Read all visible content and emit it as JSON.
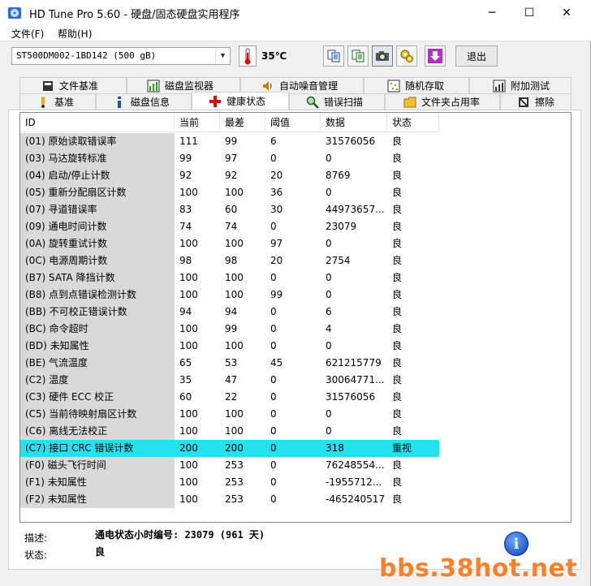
{
  "window": {
    "title": "HD Tune Pro 5.60 - 硬盘/固态硬盘实用程序",
    "minimize": "─",
    "maximize": "☐",
    "close": "✕"
  },
  "menu": {
    "file": "文件(F)",
    "help": "帮助(H)"
  },
  "toolbar": {
    "drive": "ST500DM002-1BD142 (500 gB)",
    "temperature": "35℃",
    "exit_label": "退出"
  },
  "tabs_top": [
    {
      "label": "文件基准",
      "icon": "file-benchmark-icon"
    },
    {
      "label": "磁盘监视器",
      "icon": "disk-monitor-icon"
    },
    {
      "label": "自动噪音管理",
      "icon": "speaker-icon"
    },
    {
      "label": "随机存取",
      "icon": "random-access-icon"
    },
    {
      "label": "附加测试",
      "icon": "extra-tests-icon"
    }
  ],
  "tabs_bottom": [
    {
      "label": "基准",
      "icon": "benchmark-icon"
    },
    {
      "label": "磁盘信息",
      "icon": "info-icon"
    },
    {
      "label": "健康状态",
      "icon": "health-cross-icon"
    },
    {
      "label": "错误扫描",
      "icon": "magnifier-icon"
    },
    {
      "label": "文件夹占用率",
      "icon": "folder-icon"
    },
    {
      "label": "擦除",
      "icon": "erase-icon"
    }
  ],
  "table": {
    "headers": [
      "ID",
      "当前",
      "最差",
      "阈值",
      "数据",
      "状态"
    ],
    "rows": [
      {
        "id": "(01) 原始读取错误率",
        "current": "111",
        "worst": "99",
        "threshold": "6",
        "data": "31576056",
        "status": "良"
      },
      {
        "id": "(03) 马达旋转标准",
        "current": "99",
        "worst": "97",
        "threshold": "0",
        "data": "0",
        "status": "良"
      },
      {
        "id": "(04) 启动/停止计数",
        "current": "92",
        "worst": "92",
        "threshold": "20",
        "data": "8769",
        "status": "良"
      },
      {
        "id": "(05) 重新分配扇区计数",
        "current": "100",
        "worst": "100",
        "threshold": "36",
        "data": "0",
        "status": "良"
      },
      {
        "id": "(07) 寻道错误率",
        "current": "83",
        "worst": "60",
        "threshold": "30",
        "data": "44973657...",
        "status": "良"
      },
      {
        "id": "(09) 通电时间计数",
        "current": "74",
        "worst": "74",
        "threshold": "0",
        "data": "23079",
        "status": "良"
      },
      {
        "id": "(0A) 旋转重试计数",
        "current": "100",
        "worst": "100",
        "threshold": "97",
        "data": "0",
        "status": "良"
      },
      {
        "id": "(0C) 电源周期计数",
        "current": "98",
        "worst": "98",
        "threshold": "20",
        "data": "2754",
        "status": "良"
      },
      {
        "id": "(B7) SATA 降挡计数",
        "current": "100",
        "worst": "100",
        "threshold": "0",
        "data": "0",
        "status": "良"
      },
      {
        "id": "(B8) 点到点错误检测计数",
        "current": "100",
        "worst": "100",
        "threshold": "99",
        "data": "0",
        "status": "良"
      },
      {
        "id": "(BB) 不可校正错误计数",
        "current": "94",
        "worst": "94",
        "threshold": "0",
        "data": "6",
        "status": "良"
      },
      {
        "id": "(BC) 命令超时",
        "current": "100",
        "worst": "99",
        "threshold": "0",
        "data": "4",
        "status": "良"
      },
      {
        "id": "(BD) 未知属性",
        "current": "100",
        "worst": "100",
        "threshold": "0",
        "data": "0",
        "status": "良"
      },
      {
        "id": "(BE) 气流温度",
        "current": "65",
        "worst": "53",
        "threshold": "45",
        "data": "621215779",
        "status": "良"
      },
      {
        "id": "(C2) 温度",
        "current": "35",
        "worst": "47",
        "threshold": "0",
        "data": "30064771...",
        "status": "良"
      },
      {
        "id": "(C3) 硬件 ECC 校正",
        "current": "60",
        "worst": "22",
        "threshold": "0",
        "data": "31576056",
        "status": "良"
      },
      {
        "id": "(C5) 当前待映射扇区计数",
        "current": "100",
        "worst": "100",
        "threshold": "0",
        "data": "0",
        "status": "良"
      },
      {
        "id": "(C6) 离线无法校正",
        "current": "100",
        "worst": "100",
        "threshold": "0",
        "data": "0",
        "status": "良"
      },
      {
        "id": "(C7) 接口 CRC 错误计数",
        "current": "200",
        "worst": "200",
        "threshold": "0",
        "data": "318",
        "status": "重视",
        "highlight": true
      },
      {
        "id": "(F0) 磁头飞行时间",
        "current": "100",
        "worst": "253",
        "threshold": "0",
        "data": "76248554...",
        "status": "良"
      },
      {
        "id": "(F1) 未知属性",
        "current": "100",
        "worst": "253",
        "threshold": "0",
        "data": "-1955712...",
        "status": "良"
      },
      {
        "id": "(F2) 未知属性",
        "current": "100",
        "worst": "253",
        "threshold": "0",
        "data": "-465240517",
        "status": "良"
      }
    ]
  },
  "footer": {
    "desc_label": "描述:",
    "desc_value": "通电状态小时编号: 23079 (961 天)",
    "status_label": "状态:",
    "status_value": "良"
  },
  "watermark": "bbs.38hot.net",
  "colors": {
    "highlight": "#22e2f0",
    "id_cell": "#d9d9d9",
    "watermark": "#ff7f2a"
  }
}
